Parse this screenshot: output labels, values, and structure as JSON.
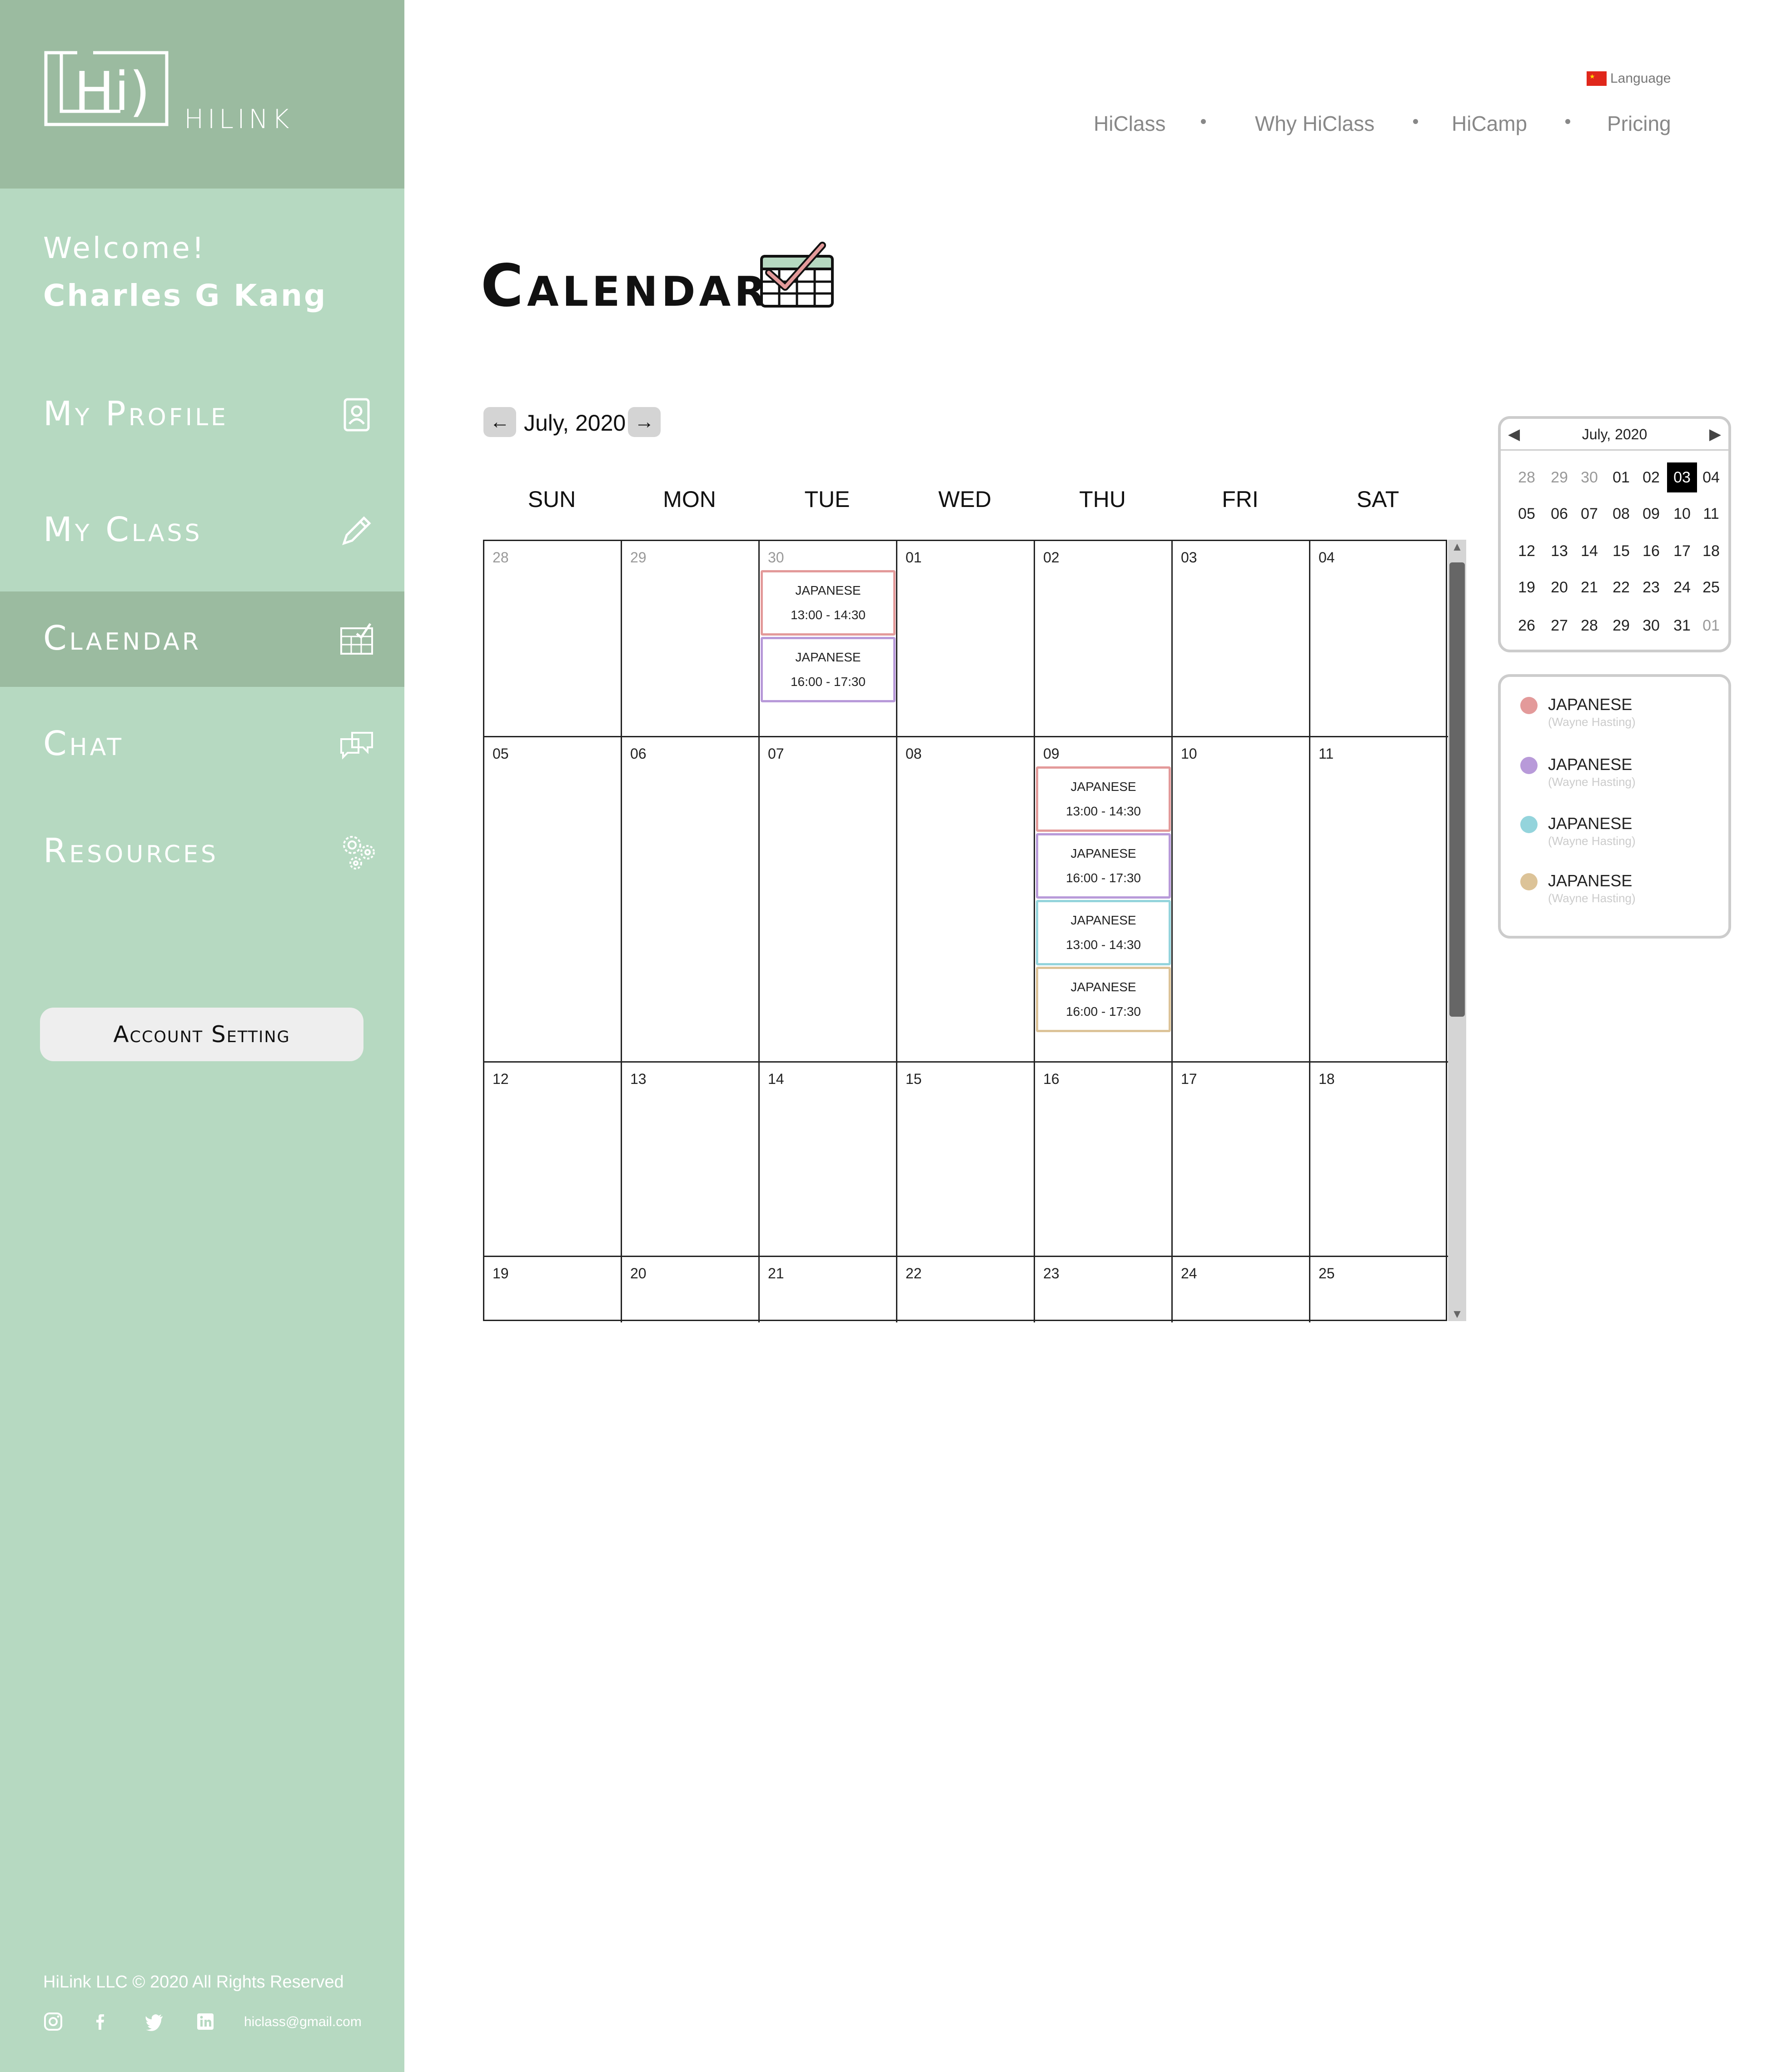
{
  "brand": {
    "logo_text": "HILINK"
  },
  "sidebar": {
    "welcome": "Welcome!",
    "username": "Charles G Kang",
    "items": [
      {
        "label": "My Profile",
        "icon": "profile-icon"
      },
      {
        "label": "My Class",
        "icon": "pencil-icon"
      },
      {
        "label": "Claendar",
        "icon": "calendar-icon",
        "active": true
      },
      {
        "label": "Chat",
        "icon": "chat-icon"
      },
      {
        "label": "Resources",
        "icon": "gears-icon"
      }
    ],
    "account_button": "Account Setting",
    "footer_copyright": "HiLink LLC © 2020 All Rights Reserved",
    "footer_email": "hiclass@gmail.com",
    "social_icons": [
      "instagram-icon",
      "facebook-icon",
      "twitter-icon",
      "linkedin-icon"
    ]
  },
  "topnav": {
    "language_label": "Language",
    "links": [
      "HiClass",
      "Why HiClass",
      "HiCamp",
      "Pricing"
    ]
  },
  "page": {
    "title": "Calendar"
  },
  "calendar": {
    "month_label": "July, 2020",
    "prev_icon": "←",
    "next_icon": "→",
    "weekdays": [
      "SUN",
      "MON",
      "TUE",
      "WED",
      "THU",
      "FRI",
      "SAT"
    ],
    "weeks": [
      [
        {
          "date": "28",
          "muted": true
        },
        {
          "date": "29",
          "muted": true
        },
        {
          "date": "30",
          "muted": true,
          "events": [
            {
              "title": "JAPANESE",
              "time": "13:00 - 14:30",
              "color": "#e39a9a"
            },
            {
              "title": "JAPANESE",
              "time": "16:00 - 17:30",
              "color": "#b89ad9"
            }
          ]
        },
        {
          "date": "01"
        },
        {
          "date": "02"
        },
        {
          "date": "03"
        },
        {
          "date": "04"
        }
      ],
      [
        {
          "date": "05"
        },
        {
          "date": "06"
        },
        {
          "date": "07"
        },
        {
          "date": "08"
        },
        {
          "date": "09",
          "events": [
            {
              "title": "JAPANESE",
              "time": "13:00 - 14:30",
              "color": "#e39a9a"
            },
            {
              "title": "JAPANESE",
              "time": "16:00 - 17:30",
              "color": "#b89ad9"
            },
            {
              "title": "JAPANESE",
              "time": "13:00 - 14:30",
              "color": "#94d4dc"
            },
            {
              "title": "JAPANESE",
              "time": "16:00 - 17:30",
              "color": "#dcc398"
            }
          ]
        },
        {
          "date": "10"
        },
        {
          "date": "11"
        }
      ],
      [
        {
          "date": "12"
        },
        {
          "date": "13"
        },
        {
          "date": "14"
        },
        {
          "date": "15"
        },
        {
          "date": "16"
        },
        {
          "date": "17"
        },
        {
          "date": "18"
        }
      ],
      [
        {
          "date": "19"
        },
        {
          "date": "20"
        },
        {
          "date": "21"
        },
        {
          "date": "22"
        },
        {
          "date": "23"
        },
        {
          "date": "24"
        },
        {
          "date": "25"
        }
      ]
    ]
  },
  "mini_calendar": {
    "title": "July, 2020",
    "prev_icon": "◀",
    "next_icon": "▶",
    "selected": "03",
    "rows": [
      [
        "28",
        "29",
        "30",
        "01",
        "02",
        "03",
        "04"
      ],
      [
        "05",
        "06",
        "07",
        "08",
        "09",
        "10",
        "11"
      ],
      [
        "12",
        "13",
        "14",
        "15",
        "16",
        "17",
        "18"
      ],
      [
        "19",
        "20",
        "21",
        "22",
        "23",
        "24",
        "25"
      ],
      [
        "26",
        "27",
        "28",
        "29",
        "30",
        "31",
        "01"
      ]
    ],
    "muted": [
      [
        0,
        0
      ],
      [
        0,
        1
      ],
      [
        0,
        2
      ],
      [
        4,
        6
      ]
    ]
  },
  "legend": [
    {
      "name": "JAPANESE",
      "teacher": "(Wayne Hasting)",
      "color": "#e39a9a"
    },
    {
      "name": "JAPANESE",
      "teacher": "(Wayne Hasting)",
      "color": "#b89ad9"
    },
    {
      "name": "JAPANESE",
      "teacher": "(Wayne Hasting)",
      "color": "#94d4dc"
    },
    {
      "name": "JAPANESE",
      "teacher": "(Wayne Hasting)",
      "color": "#dcc398"
    }
  ],
  "colors": {
    "sidebar_bg": "#b6d9c1",
    "sidebar_dark": "#9bbba0"
  }
}
